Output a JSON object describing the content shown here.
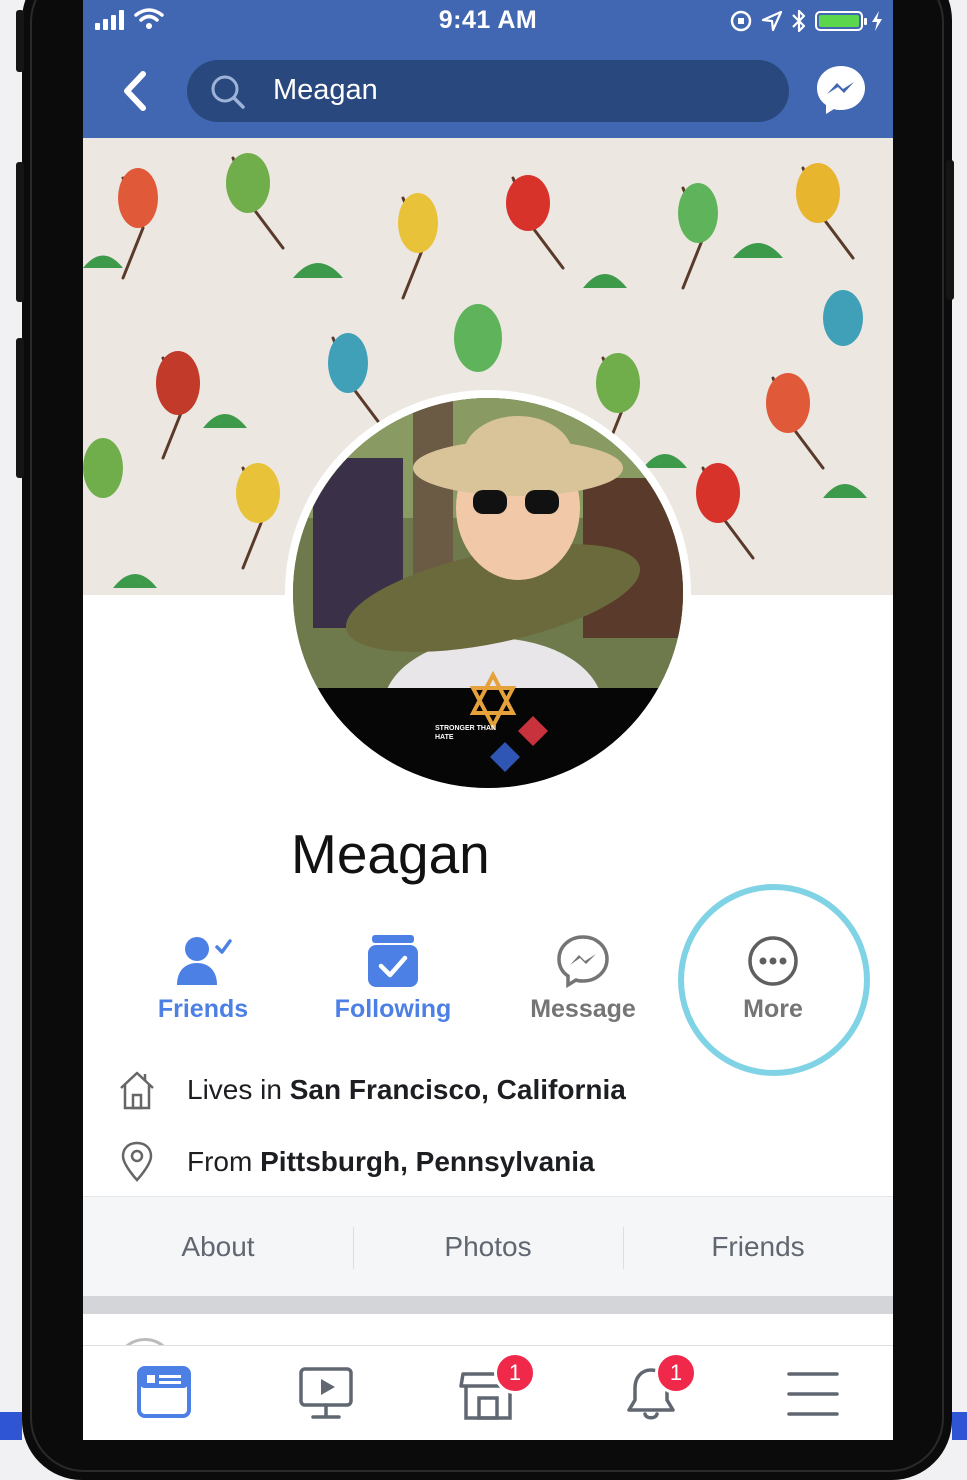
{
  "status_bar": {
    "time": "9:41 AM"
  },
  "search": {
    "query": "Meagan"
  },
  "profile": {
    "name": "Meagan",
    "frame_badge_text": "STRONGER THAN HATE"
  },
  "actions": [
    {
      "label": "Friends",
      "icon": "friends-check-icon",
      "color": "#4d80e4"
    },
    {
      "label": "Following",
      "icon": "following-check-icon",
      "color": "#4d80e4"
    },
    {
      "label": "Message",
      "icon": "messenger-icon",
      "color": "#757575"
    },
    {
      "label": "More",
      "icon": "more-dots-icon",
      "color": "#757575"
    }
  ],
  "info": {
    "lives_prefix": "Lives in ",
    "lives_place": "San Francisco, California",
    "from_prefix": "From ",
    "from_place": "Pittsburgh, Pennsylvania"
  },
  "tabs": [
    "About",
    "Photos",
    "Friends"
  ],
  "bottom_nav": [
    {
      "icon": "news-feed-icon",
      "active": true
    },
    {
      "icon": "watch-icon",
      "active": false
    },
    {
      "icon": "marketplace-icon",
      "active": false,
      "badge": "1"
    },
    {
      "icon": "notifications-icon",
      "active": false,
      "badge": "1"
    },
    {
      "icon": "menu-icon",
      "active": false
    }
  ],
  "colors": {
    "brand": "#4267b2",
    "accent": "#4d80e4",
    "highlight": "#80d3e5",
    "badge": "#f02849"
  }
}
